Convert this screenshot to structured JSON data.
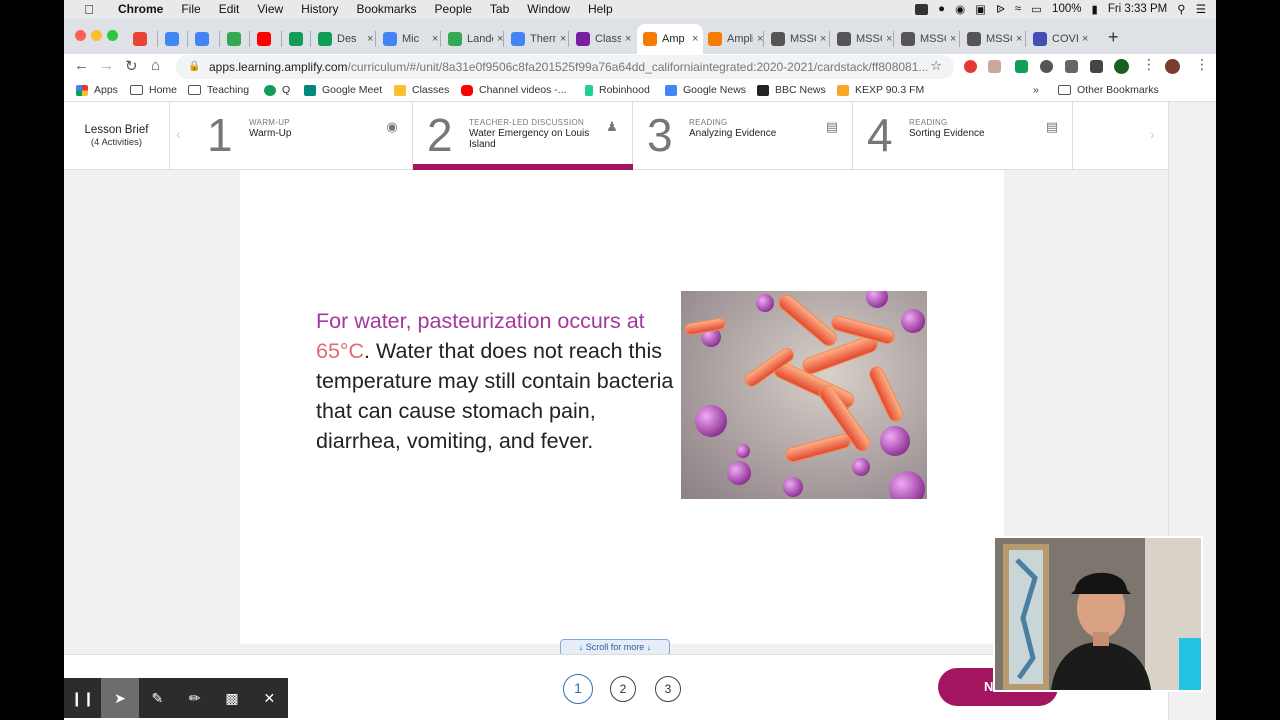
{
  "menubar": {
    "app": "Chrome",
    "items": [
      "File",
      "Edit",
      "View",
      "History",
      "Bookmarks",
      "People",
      "Tab",
      "Window",
      "Help"
    ],
    "battery": "100%",
    "clock": "Fri 3:33 PM"
  },
  "tabs": [
    {
      "label": "",
      "color": "#ea4335"
    },
    {
      "label": "",
      "color": "#4285f4"
    },
    {
      "label": "",
      "color": "#4285f4"
    },
    {
      "label": "",
      "color": "#34a853"
    },
    {
      "label": "",
      "color": "#ff0000"
    },
    {
      "label": "",
      "color": "#0f9d58"
    },
    {
      "label": "Des",
      "color": "#0f9d58"
    },
    {
      "label": "Mic",
      "color": "#4285f4"
    },
    {
      "label": "Landed",
      "color": "#34a853"
    },
    {
      "label": "Therma",
      "color": "#4285f4"
    },
    {
      "label": "Classw",
      "color": "#7b1fa2"
    },
    {
      "label": "Amp",
      "color": "#f57c00"
    },
    {
      "label": "Amplify",
      "color": "#f57c00"
    },
    {
      "label": "MSSCL",
      "color": "#555555"
    },
    {
      "label": "MSSCL",
      "color": "#555555"
    },
    {
      "label": "MSSCL",
      "color": "#555555"
    },
    {
      "label": "MSSCL",
      "color": "#555555"
    },
    {
      "label": "COVID",
      "color": "#3f51b5"
    }
  ],
  "address": {
    "host": "apps.learning.amplify.com",
    "path": "/curriculum/#/unit/8a31e0f9506c8fa201525f99a76a64dd_californiaintegrated:2020-2021/cardstack/ff808081..."
  },
  "bookmarks": [
    {
      "label": "Apps",
      "color": "#e53935"
    },
    {
      "label": "Home",
      "color": "folder"
    },
    {
      "label": "Teaching",
      "color": "folder"
    },
    {
      "label": "Q",
      "color": "#0f9d58"
    },
    {
      "label": "Google Meet",
      "color": "#00897b"
    },
    {
      "label": "Classes",
      "color": "#fbc02d"
    },
    {
      "label": "Channel videos -...",
      "color": "#ff0000"
    },
    {
      "label": "Robinhood",
      "color": "#21ce99"
    },
    {
      "label": "Google News",
      "color": "#4285f4"
    },
    {
      "label": "BBC News",
      "color": "#222222"
    },
    {
      "label": "KEXP 90.3 FM",
      "color": "#f9a825"
    }
  ],
  "bookmarks_more": "»",
  "bookmarks_other": "Other Bookmarks",
  "lesson": {
    "brief_title": "Lesson Brief",
    "brief_sub": "(4 Activities)",
    "activities": [
      {
        "num": "1",
        "cat": "WARM-UP",
        "name": "Warm-Up",
        "icon": "head-icon"
      },
      {
        "num": "2",
        "cat": "TEACHER-LED DISCUSSION",
        "name": "Water Emergency on Louis Island",
        "icon": "people-icon"
      },
      {
        "num": "3",
        "cat": "READING",
        "name": "Analyzing Evidence",
        "icon": "reading-icon"
      },
      {
        "num": "4",
        "cat": "READING",
        "name": "Sorting Evidence",
        "icon": "reading-icon"
      }
    ]
  },
  "card": {
    "highlight1": "For water, pasteurization occurs at",
    "highlight2": "65°C",
    "rest": ". Water that does not reach this temperature may still contain bacteria that can cause stomach pain, diarrhea, vomiting, and fever."
  },
  "scroll_label": "↓ Scroll for more ↓",
  "pages": [
    "1",
    "2",
    "3"
  ],
  "next_label": "N",
  "annotation_tools": [
    "pause-icon",
    "pointer-icon",
    "pen-icon",
    "highlighter-icon",
    "camera-icon",
    "close-icon"
  ],
  "colors": {
    "accent": "#a3155f",
    "highlight_purple": "#a6379c",
    "highlight_red": "#e06a72",
    "link_blue": "#2d70b9"
  }
}
